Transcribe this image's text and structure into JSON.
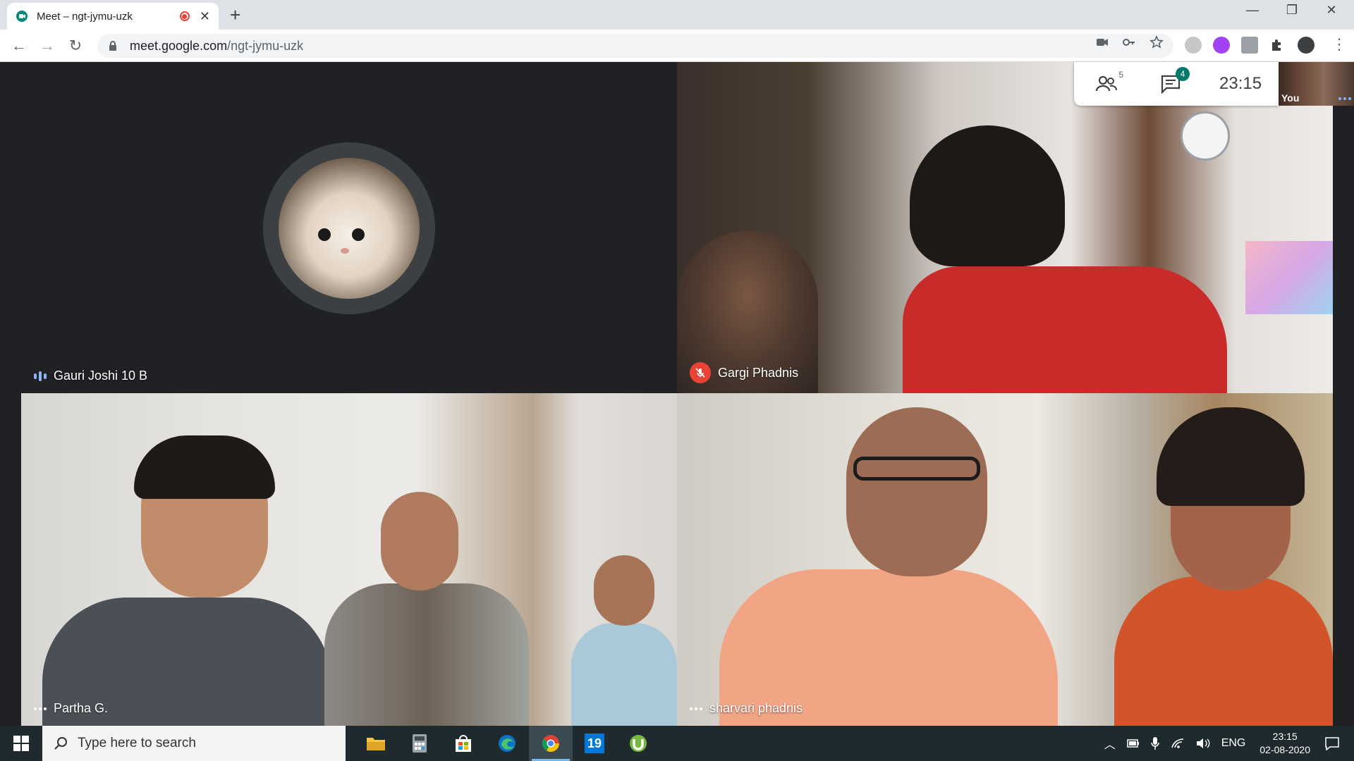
{
  "browser": {
    "tab": {
      "title": "Meet – ngt-jymu-uzk"
    },
    "url": {
      "host": "meet.google.com",
      "path": "/ngt-jymu-uzk"
    }
  },
  "meet": {
    "people_count": "5",
    "chat_badge": "4",
    "time": "23:15",
    "self_label": "You",
    "participants": [
      {
        "name": "Gauri Joshi 10 B"
      },
      {
        "name": "Gargi Phadnis"
      },
      {
        "name": "Partha G."
      },
      {
        "name": "sharvari phadnis"
      }
    ]
  },
  "taskbar": {
    "search_placeholder": "Type here to search",
    "lang": "ENG",
    "time": "23:15",
    "date": "02-08-2020",
    "calendar_app_number": "19"
  },
  "colors": {
    "meet_bg": "#202124",
    "mute_red": "#ea4335",
    "chat_badge": "#00796b",
    "taskbar": "#1f2a2e"
  }
}
